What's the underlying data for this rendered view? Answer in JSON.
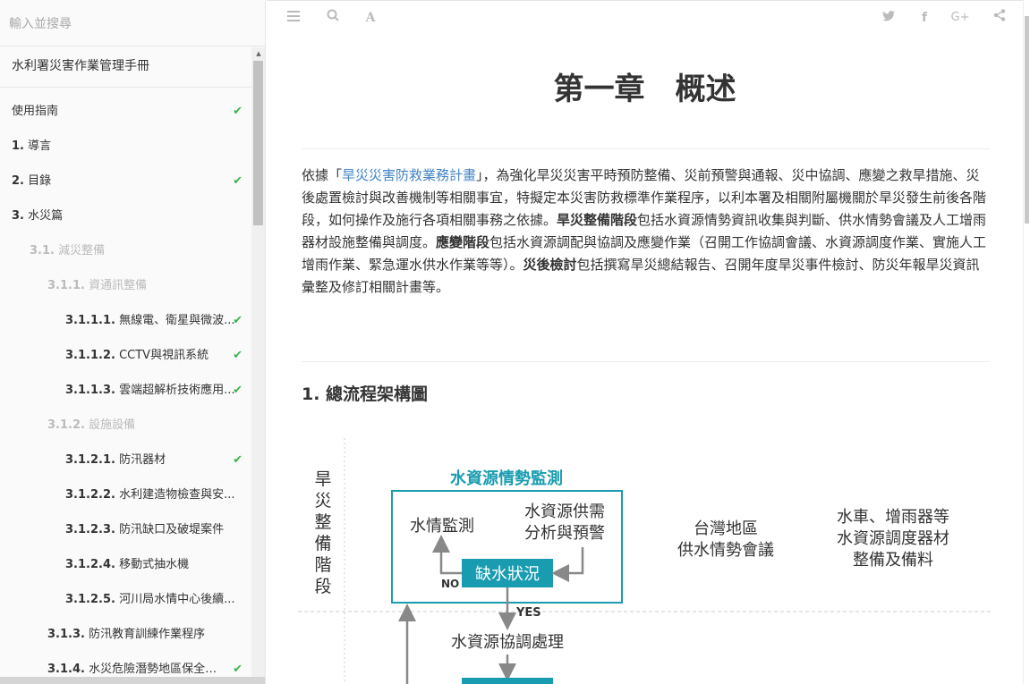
{
  "search": {
    "placeholder": "輸入並搜尋"
  },
  "sidebar": {
    "book_title": "水利署災害作業管理手冊",
    "items": [
      {
        "num": "",
        "label": "使用指南",
        "checked": true
      },
      {
        "num": "1.",
        "label": "導言",
        "checked": false
      },
      {
        "num": "2.",
        "label": "目錄",
        "checked": true
      },
      {
        "num": "3.",
        "label": "水災篇",
        "checked": false
      },
      {
        "num": "3.1.",
        "label": "減災整備",
        "checked": false
      },
      {
        "num": "3.1.1.",
        "label": "資通訊整備",
        "checked": false
      },
      {
        "num": "3.1.1.1.",
        "label": "無線電、衛星與微波...",
        "checked": true
      },
      {
        "num": "3.1.1.2.",
        "label": "CCTV與視訊系統",
        "checked": true
      },
      {
        "num": "3.1.1.3.",
        "label": "雲端超解析技術應用...",
        "checked": true
      },
      {
        "num": "3.1.2.",
        "label": "設施設備",
        "checked": false
      },
      {
        "num": "3.1.2.1.",
        "label": "防汛器材",
        "checked": true
      },
      {
        "num": "3.1.2.2.",
        "label": "水利建造物檢查與安...",
        "checked": false
      },
      {
        "num": "3.1.2.3.",
        "label": "防汛缺口及破堤案件",
        "checked": false
      },
      {
        "num": "3.1.2.4.",
        "label": "移動式抽水機",
        "checked": false
      },
      {
        "num": "3.1.2.5.",
        "label": "河川局水情中心後續...",
        "checked": false
      },
      {
        "num": "3.1.3.",
        "label": "防汛教育訓練作業程序",
        "checked": false
      },
      {
        "num": "3.1.4.",
        "label": "水災危險潛勢地區保全計...",
        "checked": true
      }
    ]
  },
  "toolbar": {
    "left_icons": [
      "menu-icon",
      "search-icon",
      "font-icon"
    ],
    "right_icons": [
      "twitter-icon",
      "facebook-icon",
      "google-plus-icon",
      "share-icon"
    ]
  },
  "content": {
    "chapter_title": "第一章　概述",
    "para_prefix": "依據「",
    "para_link": "旱災災害防救業務計畫",
    "para_1": "」，為強化旱災災害平時預防整備、災前預警與通報、災中協調、應變之救旱措施、災後處置檢討與改善機制等相關事宜，特擬定本災害防救標準作業程序，以利本署及相關附屬機關於旱災發生前後各階段，如何操作及施行各項相關事務之依據。",
    "bold_1": "旱災整備階段",
    "para_2": "包括水資源情勢資訊收集與判斷、供水情勢會議及人工增雨器材設施整備與調度。",
    "bold_2": "應變階段",
    "para_3": "包括水資源調配與協調及應變作業（召開工作協調會議、水資源調度作業、實施人工增雨作業、緊急運水供水作業等等）。",
    "bold_3": "災後檢討",
    "para_4": "包括撰寫旱災總結報告、召開年度旱災事件檢討、防災年報旱災資訊彙整及修訂相關計畫等。",
    "section_title": "1. 總流程架構圖"
  },
  "diagram": {
    "stage_label": "旱災整備階段",
    "box_title": "水資源情勢監測",
    "node_monitor": "水情監測",
    "node_supply_1": "水資源供需",
    "node_supply_2": "分析與預警",
    "node_shortage": "缺水狀況",
    "label_no": "NO",
    "label_yes": "YES",
    "node_taiwan_1": "台灣地區",
    "node_taiwan_2": "供水情勢會議",
    "node_equip_1": "水車、增雨器等",
    "node_equip_2": "水資源調度器材",
    "node_equip_3": "整備及備料",
    "node_coord": "水資源協調處理",
    "colors": {
      "accent": "#1a9cb0",
      "arrow": "#888888",
      "text": "#333333"
    }
  }
}
